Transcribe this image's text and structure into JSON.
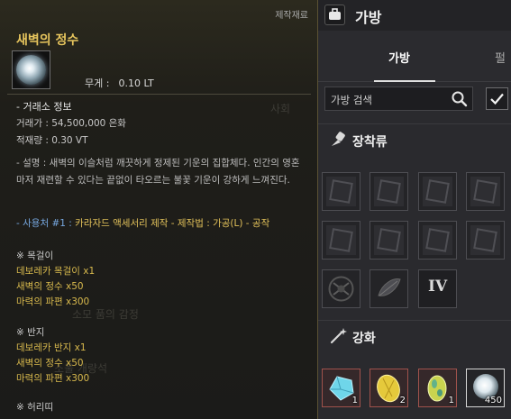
{
  "tooltip": {
    "category": "제작재료",
    "item_name": "새벽의 정수",
    "weight_label": "무게 :",
    "weight_value": "0.10 LT",
    "market_header": "- 거래소 정보",
    "price": "거래가 : 54,500,000 은화",
    "weight_limit": "적재량 : 0.30 VT",
    "description": "- 설명 : 새벽의 이슬처럼 깨끗하게 정제된 기운의 집합체다. 인간의 영혼마저 재련할 수 있다는 끝없이 타오르는 불꽃 기운이 강하게 느껴진다.",
    "usage_label": "- 사용처 #1 :",
    "usage_value": "카라자드 액세서리 제작 - 제작법 : 가공(L) - 공작",
    "recipes": [
      {
        "title": "※ 목걸이",
        "lines": [
          "데보레카 목걸이 x1",
          "새벽의 정수 x50",
          "마력의 파편 x300"
        ]
      },
      {
        "title": "※ 반지",
        "lines": [
          "데보레카 반지 x1",
          "새벽의 정수 x50",
          "마력의 파편 x300"
        ]
      },
      {
        "title": "※ 허리띠",
        "lines": []
      }
    ]
  },
  "bag": {
    "title": "가방",
    "tab_bag": "가방",
    "tab_next": "펄",
    "search_placeholder": "가방 검색",
    "section_equipment": "장착류",
    "section_enhance": "강화",
    "equipment_items": [
      {
        "kind": "equipment-box"
      },
      {
        "kind": "equipment-box"
      },
      {
        "kind": "equipment-box"
      },
      {
        "kind": "equipment-box"
      },
      {
        "kind": "equipment-box"
      },
      {
        "kind": "equipment-box"
      },
      {
        "kind": "equipment-box"
      },
      {
        "kind": "equipment-box"
      },
      {
        "kind": "round-crest"
      },
      {
        "kind": "feather-shard"
      },
      {
        "kind": "roman-numeral",
        "label": "IV"
      }
    ],
    "enhance_items": [
      {
        "kind": "blue-crystal",
        "count": "1"
      },
      {
        "kind": "yellow-crystal",
        "count": "2"
      },
      {
        "kind": "green-egg-crystal",
        "count": "1"
      },
      {
        "kind": "white-orb",
        "count": "450"
      }
    ]
  },
  "colors": {
    "title_gold": "#e7c55d",
    "usage_blue": "#77a8e0",
    "usage_gold": "#e2c15a",
    "slot_red": "#a0524c"
  }
}
